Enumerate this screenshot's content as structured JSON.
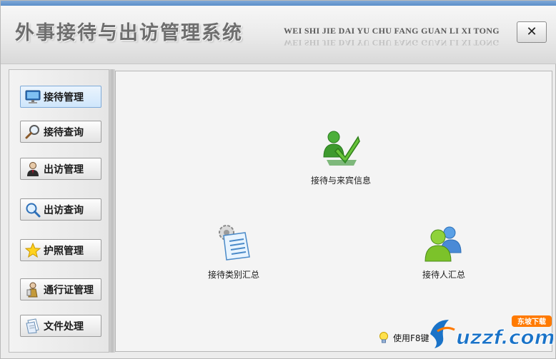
{
  "header": {
    "title": "外事接待与出访管理系统",
    "subtitle": "WEI SHI JIE DAI YU CHU FANG GUAN  LI  XI  TONG",
    "close_label": "✕"
  },
  "sidebar": {
    "items": [
      {
        "label": "接待管理",
        "icon": "monitor-icon",
        "active": true
      },
      {
        "label": "接待查询",
        "icon": "magnifier-icon"
      },
      {
        "label": "出访管理",
        "icon": "person-icon"
      },
      {
        "label": "出访查询",
        "icon": "search-icon"
      },
      {
        "label": "护照管理",
        "icon": "star-icon"
      },
      {
        "label": "通行证管理",
        "icon": "pass-icon"
      },
      {
        "label": "文件处理",
        "icon": "document-icon"
      }
    ]
  },
  "main": {
    "tiles": [
      {
        "label": "接待与来宾信息",
        "icon": "users-check-icon"
      },
      {
        "label": "接待类别汇总",
        "icon": "gear-document-icon"
      },
      {
        "label": "接待人汇总",
        "icon": "users-icon"
      }
    ],
    "hint": "使用F8键"
  },
  "watermark": {
    "text": "uzzf.com",
    "badge": "东坡下载"
  },
  "colors": {
    "accent": "#5b8ec8",
    "green": "#3aa63a",
    "watermark_blue": "#1a73c8",
    "watermark_orange": "#ff7a00"
  }
}
